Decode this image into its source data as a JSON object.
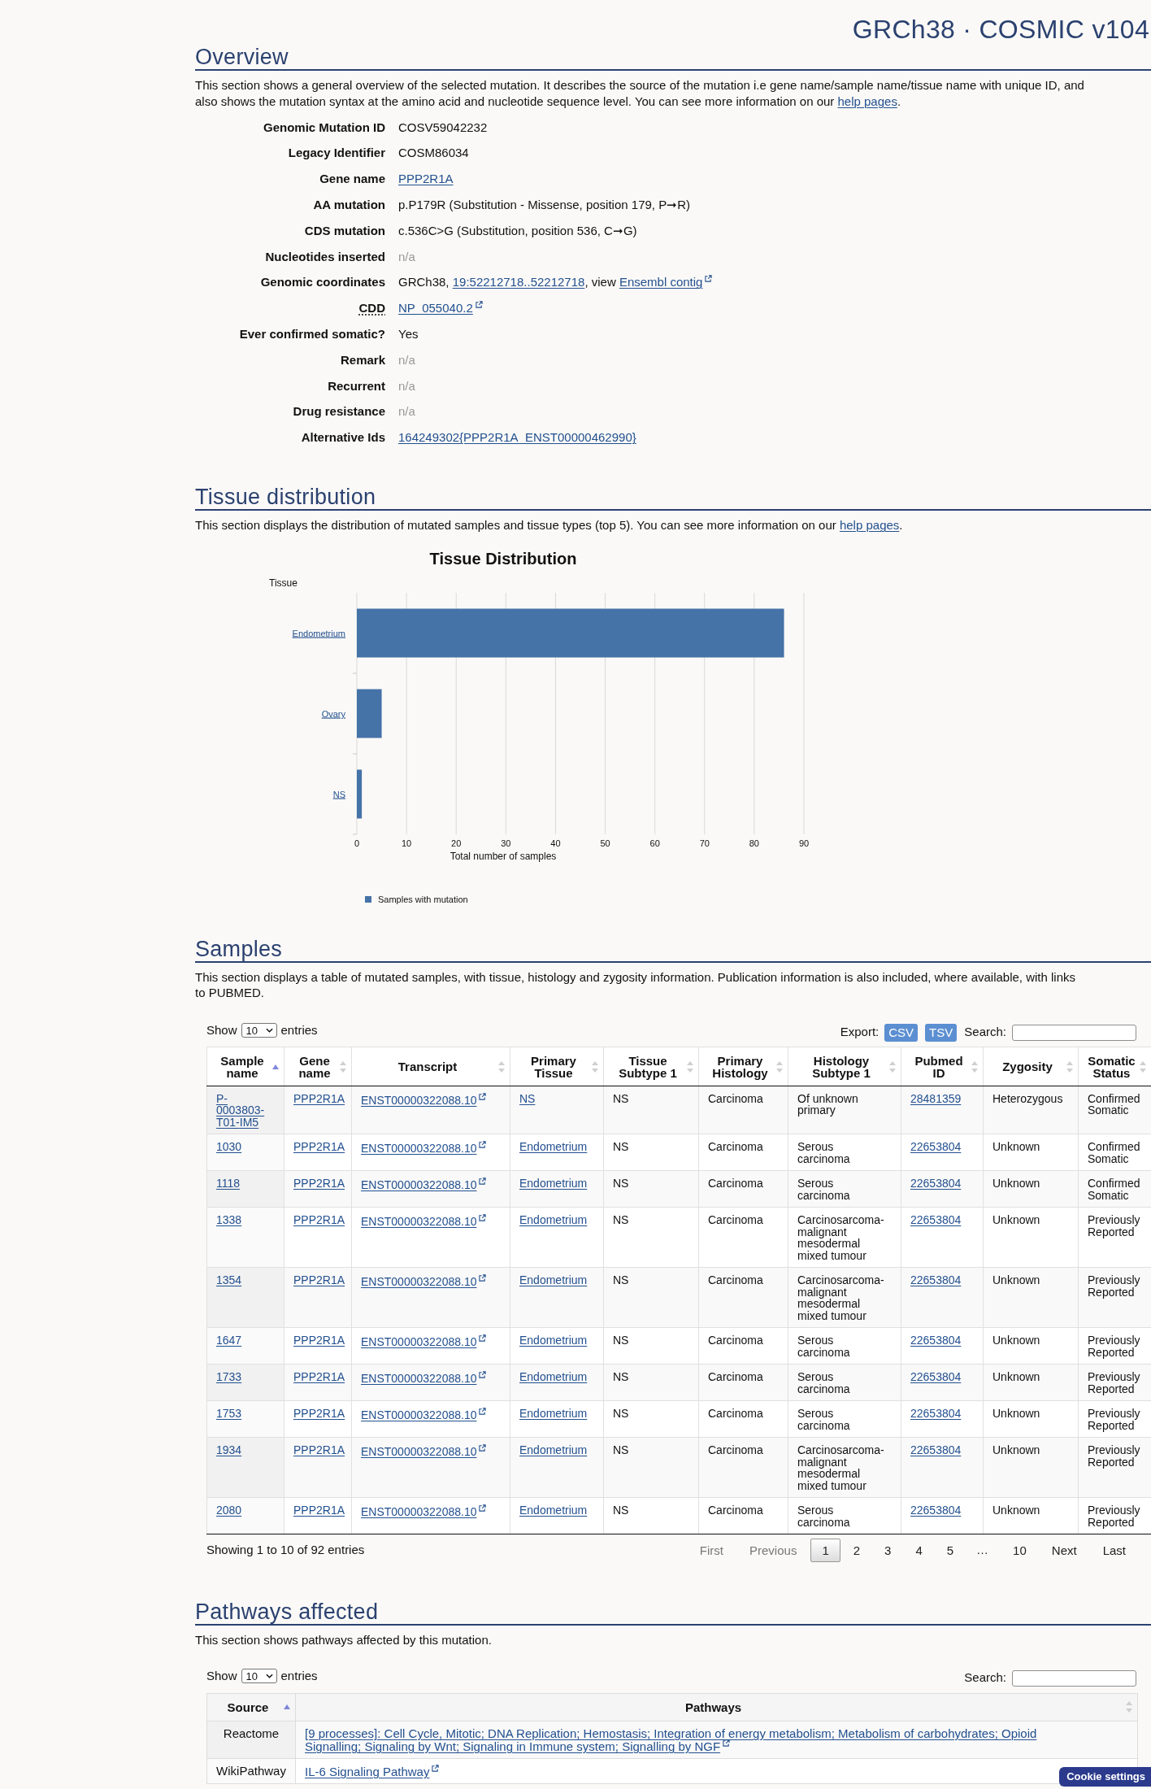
{
  "header": {
    "title": "GRCh38 · COSMIC v104"
  },
  "overview": {
    "heading": "Overview",
    "description": {
      "text": "This section shows a general overview of the selected mutation. It describes the source of the mutation i.e gene name/sample name/tissue name with unique ID, and also shows the mutation syntax at the amino acid and nucleotide sequence level. You can see more information on our",
      "link": "help pages",
      "after": "."
    },
    "fields": [
      {
        "label": "Genomic Mutation ID",
        "abbr": false,
        "value": [
          {
            "kind": "text",
            "text": "COSV59042232"
          }
        ]
      },
      {
        "label": "Legacy Identifier",
        "abbr": false,
        "value": [
          {
            "kind": "text",
            "text": "COSM86034"
          }
        ]
      },
      {
        "label": "Gene name",
        "abbr": false,
        "value": [
          {
            "kind": "link",
            "text": "PPP2R1A"
          }
        ]
      },
      {
        "label": "AA mutation",
        "abbr": false,
        "value": [
          {
            "kind": "text",
            "text": "p.P179R (Substitution - Missense, position 179, P➞R)"
          }
        ]
      },
      {
        "label": "CDS mutation",
        "abbr": false,
        "value": [
          {
            "kind": "text",
            "text": "c.536C>G (Substitution, position 536, C➞G)"
          }
        ]
      },
      {
        "label": "Nucleotides inserted",
        "abbr": false,
        "value": [
          {
            "kind": "muted",
            "text": "n/a"
          }
        ]
      },
      {
        "label": "Genomic coordinates",
        "abbr": false,
        "value": [
          {
            "kind": "text",
            "text": "GRCh38, "
          },
          {
            "kind": "link",
            "text": "19:52212718..52212718"
          },
          {
            "kind": "text",
            "text": ", view "
          },
          {
            "kind": "external_link",
            "text": "Ensembl contig"
          }
        ]
      },
      {
        "label": "CDD",
        "abbr": true,
        "value": [
          {
            "kind": "external_link",
            "text": "NP_055040.2"
          }
        ]
      },
      {
        "label": "Ever confirmed somatic?",
        "abbr": false,
        "value": [
          {
            "kind": "text",
            "text": "Yes"
          }
        ]
      },
      {
        "label": "Remark",
        "abbr": false,
        "value": [
          {
            "kind": "muted",
            "text": "n/a"
          }
        ]
      },
      {
        "label": "Recurrent",
        "abbr": false,
        "value": [
          {
            "kind": "muted",
            "text": "n/a"
          }
        ]
      },
      {
        "label": "Drug resistance",
        "abbr": false,
        "value": [
          {
            "kind": "muted",
            "text": "n/a"
          }
        ]
      },
      {
        "label": "Alternative Ids",
        "abbr": false,
        "value": [
          {
            "kind": "link",
            "text": "164249302{PPP2R1A_ENST00000462990}"
          }
        ]
      }
    ]
  },
  "tissue": {
    "heading": "Tissue distribution",
    "description": {
      "text": "This section displays the distribution of mutated samples and tissue types (top 5). You can see more information on our",
      "link": "help pages",
      "after": "."
    },
    "chart_data": {
      "type": "bar",
      "orientation": "horizontal",
      "grid": true,
      "title": "Tissue Distribution",
      "xlabel": "Total number of samples",
      "ylabel": "Tissue",
      "categories": [
        "Endometrium",
        "Ovary",
        "NS"
      ],
      "series": [
        {
          "name": "Samples with mutation",
          "color": "#4572a7",
          "values": [
            86,
            5,
            1
          ]
        }
      ],
      "xlim": [
        0,
        90
      ],
      "xticks": [
        0,
        10,
        20,
        30,
        40,
        50,
        60,
        70,
        80,
        90
      ]
    }
  },
  "samples": {
    "heading": "Samples",
    "description": {
      "text": "This section displays a table of mutated samples, with tissue, histology and zygosity information. Publication information is also included, where available, with links to PUBMED."
    },
    "length_menu": {
      "before": "Show",
      "value": "10",
      "after": "entries"
    },
    "export": {
      "label": "Export:",
      "buttons": [
        "CSV",
        "TSV"
      ]
    },
    "search": {
      "label": "Search:"
    },
    "table": {
      "columns": [
        {
          "label": "Sample name",
          "sorted": true,
          "kind": "link"
        },
        {
          "label": "Gene name",
          "sorted": false,
          "kind": "link"
        },
        {
          "label": "Transcript",
          "sorted": false,
          "kind": "external_link"
        },
        {
          "label": "Primary Tissue",
          "sorted": false,
          "kind": "link"
        },
        {
          "label": "Tissue Subtype 1",
          "sorted": false,
          "kind": "text"
        },
        {
          "label": "Primary Histology",
          "sorted": false,
          "kind": "text"
        },
        {
          "label": "Histology Subtype 1",
          "sorted": false,
          "kind": "text"
        },
        {
          "label": "Pubmed ID",
          "sorted": false,
          "kind": "link"
        },
        {
          "label": "Zygosity",
          "sorted": false,
          "kind": "text"
        },
        {
          "label": "Somatic Status",
          "sorted": false,
          "kind": "text"
        }
      ],
      "rows": [
        [
          "P-0003803-T01-IM5",
          "PPP2R1A",
          "ENST00000322088.10",
          "NS",
          "NS",
          "Carcinoma",
          "Of unknown primary",
          "28481359",
          "Heterozygous",
          "Confirmed Somatic"
        ],
        [
          "1030",
          "PPP2R1A",
          "ENST00000322088.10",
          "Endometrium",
          "NS",
          "Carcinoma",
          "Serous carcinoma",
          "22653804",
          "Unknown",
          "Confirmed Somatic"
        ],
        [
          "1118",
          "PPP2R1A",
          "ENST00000322088.10",
          "Endometrium",
          "NS",
          "Carcinoma",
          "Serous carcinoma",
          "22653804",
          "Unknown",
          "Confirmed Somatic"
        ],
        [
          "1338",
          "PPP2R1A",
          "ENST00000322088.10",
          "Endometrium",
          "NS",
          "Carcinoma",
          "Carcinosarcoma-malignant mesodermal mixed tumour",
          "22653804",
          "Unknown",
          "Previously Reported"
        ],
        [
          "1354",
          "PPP2R1A",
          "ENST00000322088.10",
          "Endometrium",
          "NS",
          "Carcinoma",
          "Carcinosarcoma-malignant mesodermal mixed tumour",
          "22653804",
          "Unknown",
          "Previously Reported"
        ],
        [
          "1647",
          "PPP2R1A",
          "ENST00000322088.10",
          "Endometrium",
          "NS",
          "Carcinoma",
          "Serous carcinoma",
          "22653804",
          "Unknown",
          "Previously Reported"
        ],
        [
          "1733",
          "PPP2R1A",
          "ENST00000322088.10",
          "Endometrium",
          "NS",
          "Carcinoma",
          "Serous carcinoma",
          "22653804",
          "Unknown",
          "Previously Reported"
        ],
        [
          "1753",
          "PPP2R1A",
          "ENST00000322088.10",
          "Endometrium",
          "NS",
          "Carcinoma",
          "Serous carcinoma",
          "22653804",
          "Unknown",
          "Previously Reported"
        ],
        [
          "1934",
          "PPP2R1A",
          "ENST00000322088.10",
          "Endometrium",
          "NS",
          "Carcinoma",
          "Carcinosarcoma-malignant mesodermal mixed tumour",
          "22653804",
          "Unknown",
          "Previously Reported"
        ],
        [
          "2080",
          "PPP2R1A",
          "ENST00000322088.10",
          "Endometrium",
          "NS",
          "Carcinoma",
          "Serous carcinoma",
          "22653804",
          "Unknown",
          "Previously Reported"
        ]
      ]
    },
    "info": "Showing 1 to 10 of 92 entries",
    "pagination": [
      {
        "kind": "nav",
        "label": "First",
        "disabled": true
      },
      {
        "kind": "nav",
        "label": "Previous",
        "disabled": true
      },
      {
        "kind": "page",
        "label": "1",
        "selected": true
      },
      {
        "kind": "page",
        "label": "2",
        "selected": false
      },
      {
        "kind": "page",
        "label": "3",
        "selected": false
      },
      {
        "kind": "page",
        "label": "4",
        "selected": false
      },
      {
        "kind": "page",
        "label": "5",
        "selected": false
      },
      {
        "kind": "ellipsis",
        "label": "…"
      },
      {
        "kind": "page",
        "label": "10",
        "selected": false
      },
      {
        "kind": "nav",
        "label": "Next",
        "disabled": false
      },
      {
        "kind": "nav",
        "label": "Last",
        "disabled": false
      }
    ]
  },
  "pathways": {
    "heading": "Pathways affected",
    "description": {
      "text": "This section shows pathways affected by this mutation."
    },
    "length_menu": {
      "before": "Show",
      "value": "10",
      "after": "entries"
    },
    "search": {
      "label": "Search:"
    },
    "table": {
      "columns": [
        {
          "label": "Source",
          "sorted": true
        },
        {
          "label": "Pathways",
          "sorted": false
        }
      ],
      "rows": [
        {
          "source": "Reactome",
          "pathways": "[9 processes]: Cell Cycle, Mitotic; DNA Replication; Hemostasis; Integration of energy metabolism; Metabolism of carbohydrates; Opioid Signalling; Signaling by Wnt; Signaling in Immune system; Signalling by NGF"
        },
        {
          "source": "WikiPathway",
          "pathways": "IL-6 Signaling Pathway"
        }
      ]
    }
  },
  "cookie_button": "Cookie settings"
}
